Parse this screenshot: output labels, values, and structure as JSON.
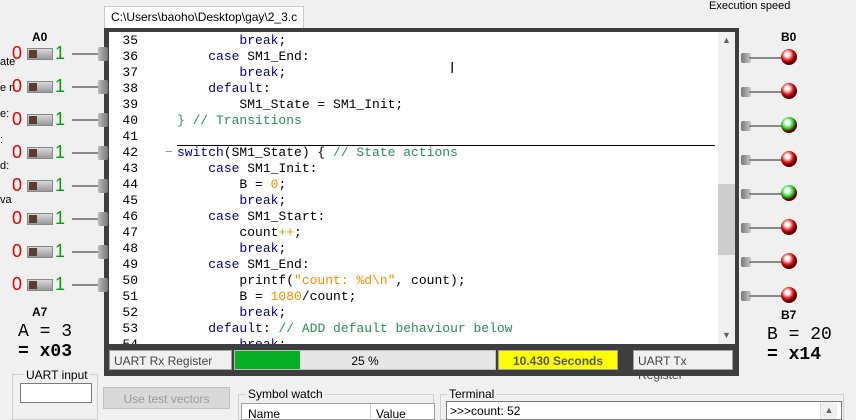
{
  "window": {
    "tab_title": "C:\\Users\\baoho\\Desktop\\gay\\2_3.c",
    "execution_speed_label": "Execution speed"
  },
  "left_clipped_labels": [
    "ate",
    "e n",
    "e:",
    ":",
    "d:",
    "va"
  ],
  "editor": {
    "lines": [
      {
        "n": "35",
        "parts": [
          {
            "t": "        ",
            "c": "pl"
          },
          {
            "t": "break",
            "c": "kw"
          },
          {
            "t": ";",
            "c": "pl"
          }
        ]
      },
      {
        "n": "36",
        "parts": [
          {
            "t": "    ",
            "c": "pl"
          },
          {
            "t": "case",
            "c": "kw"
          },
          {
            "t": " SM1_End:",
            "c": "pl"
          }
        ]
      },
      {
        "n": "37",
        "parts": [
          {
            "t": "        ",
            "c": "pl"
          },
          {
            "t": "break",
            "c": "kw"
          },
          {
            "t": ";",
            "c": "pl"
          }
        ]
      },
      {
        "n": "38",
        "parts": [
          {
            "t": "    ",
            "c": "pl"
          },
          {
            "t": "default",
            "c": "kw"
          },
          {
            "t": ":",
            "c": "pl"
          }
        ]
      },
      {
        "n": "39",
        "parts": [
          {
            "t": "        SM1_State = SM1_Init;",
            "c": "pl"
          }
        ]
      },
      {
        "n": "40",
        "parts": [
          {
            "t": "} // Transitions",
            "c": "cm"
          }
        ]
      },
      {
        "n": "41",
        "parts": []
      },
      {
        "n": "42",
        "fold": "−",
        "parts": [
          {
            "t": "switch",
            "c": "kw"
          },
          {
            "t": "(SM1_State) { ",
            "c": "pl"
          },
          {
            "t": "// State actions",
            "c": "cm"
          }
        ]
      },
      {
        "n": "43",
        "parts": [
          {
            "t": "    ",
            "c": "pl"
          },
          {
            "t": "case",
            "c": "kw"
          },
          {
            "t": " SM1_Init:",
            "c": "pl"
          }
        ]
      },
      {
        "n": "44",
        "parts": [
          {
            "t": "        B = ",
            "c": "pl"
          },
          {
            "t": "0",
            "c": "num"
          },
          {
            "t": ";",
            "c": "pl"
          }
        ]
      },
      {
        "n": "45",
        "parts": [
          {
            "t": "        ",
            "c": "pl"
          },
          {
            "t": "break",
            "c": "kw"
          },
          {
            "t": ";",
            "c": "pl"
          }
        ]
      },
      {
        "n": "46",
        "parts": [
          {
            "t": "    ",
            "c": "pl"
          },
          {
            "t": "case",
            "c": "kw"
          },
          {
            "t": " SM1_Start:",
            "c": "pl"
          }
        ]
      },
      {
        "n": "47",
        "parts": [
          {
            "t": "        count",
            "c": "pl"
          },
          {
            "t": "++",
            "c": "num"
          },
          {
            "t": ";",
            "c": "pl"
          }
        ]
      },
      {
        "n": "48",
        "parts": [
          {
            "t": "        ",
            "c": "pl"
          },
          {
            "t": "break",
            "c": "kw"
          },
          {
            "t": ";",
            "c": "pl"
          }
        ]
      },
      {
        "n": "49",
        "parts": [
          {
            "t": "    ",
            "c": "pl"
          },
          {
            "t": "case",
            "c": "kw"
          },
          {
            "t": " SM1_End:",
            "c": "pl"
          }
        ]
      },
      {
        "n": "50",
        "parts": [
          {
            "t": "        printf(",
            "c": "pl"
          },
          {
            "t": "\"count: %d\\n\"",
            "c": "str"
          },
          {
            "t": ", count);",
            "c": "pl"
          }
        ]
      },
      {
        "n": "51",
        "parts": [
          {
            "t": "        B = ",
            "c": "pl"
          },
          {
            "t": "1080",
            "c": "num"
          },
          {
            "t": "/count;",
            "c": "pl"
          }
        ]
      },
      {
        "n": "52",
        "parts": [
          {
            "t": "        ",
            "c": "pl"
          },
          {
            "t": "break",
            "c": "kw"
          },
          {
            "t": ";",
            "c": "pl"
          }
        ]
      },
      {
        "n": "53",
        "parts": [
          {
            "t": "    ",
            "c": "pl"
          },
          {
            "t": "default",
            "c": "kw"
          },
          {
            "t": ": ",
            "c": "pl"
          },
          {
            "t": "// ADD default behaviour below",
            "c": "cm"
          }
        ]
      },
      {
        "n": "54",
        "parts": [
          {
            "t": "        ",
            "c": "pl"
          },
          {
            "t": "break",
            "c": "kw"
          },
          {
            "t": ";",
            "c": "pl"
          }
        ]
      }
    ]
  },
  "status": {
    "uart_rx_label": "UART Rx Register",
    "progress_text": "25 %",
    "progress_fraction": 0.25,
    "timer_text": "10.430 Seconds",
    "uart_tx_label": "UART Tx Register"
  },
  "inputs_a": {
    "top_label": "A0",
    "bottom_label": "A7",
    "zero": "0",
    "one": "1",
    "count": 8,
    "value_dec": "A = 3",
    "value_hex": "= x03"
  },
  "outputs_b": {
    "top_label": "B0",
    "bottom_label": "B7",
    "leds": [
      "red",
      "red",
      "green",
      "red",
      "green",
      "red",
      "red",
      "red"
    ],
    "value_dec": "B = 20",
    "value_hex": "= x14"
  },
  "colors": {
    "led_red": "#e01010",
    "led_green": "#22cc22",
    "progress": "#06b025",
    "timer_bg": "#ffff00"
  },
  "bottom": {
    "uart_input_label": "UART input",
    "uart_input_value": "",
    "test_vectors_label": "Use test vectors",
    "symbol_watch_label": "Symbol watch",
    "symbol_columns": [
      "Name",
      "Value"
    ],
    "terminal_label": "Terminal",
    "terminal_line": ">>>count: 52"
  }
}
